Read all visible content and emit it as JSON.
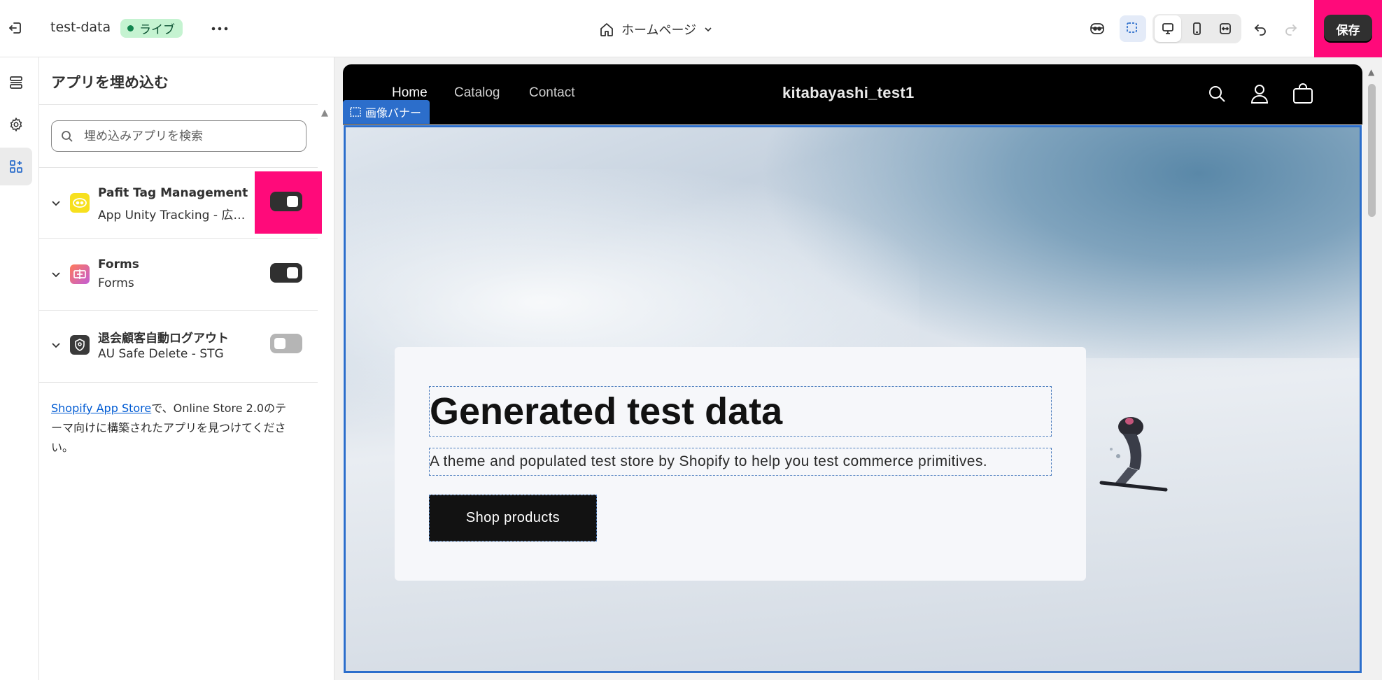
{
  "topbar": {
    "store_name": "test-data",
    "live_badge": "ライブ",
    "page_selector": "ホームページ",
    "save_label": "保存"
  },
  "panel": {
    "title": "アプリを埋め込む",
    "search_placeholder": "埋め込みアプリを検索",
    "apps": [
      {
        "name": "Pafit Tag Management",
        "subtitle": "App Unity Tracking - 広告連携",
        "enabled": true
      },
      {
        "name": "Forms",
        "subtitle": "Forms",
        "enabled": true
      },
      {
        "name": "退会顧客自動ログアウト",
        "subtitle": "AU Safe Delete - STG",
        "enabled": false
      }
    ],
    "footer_link": "Shopify App Store",
    "footer_text": "で、Online Store 2.0のテーマ向けに構築されたアプリを見つけてください。"
  },
  "preview": {
    "nav": [
      "Home",
      "Catalog",
      "Contact"
    ],
    "store_logo": "kitabayashi_test1",
    "section_tag": "画像バナー",
    "heading": "Generated test data",
    "subtext": "A theme and populated test store by Shopify to help you test commerce primitives.",
    "button": "Shop products"
  },
  "colors": {
    "highlight": "#ff0a7a",
    "selection": "#2c6ecb",
    "live_badge_bg": "#c5f3d1"
  }
}
